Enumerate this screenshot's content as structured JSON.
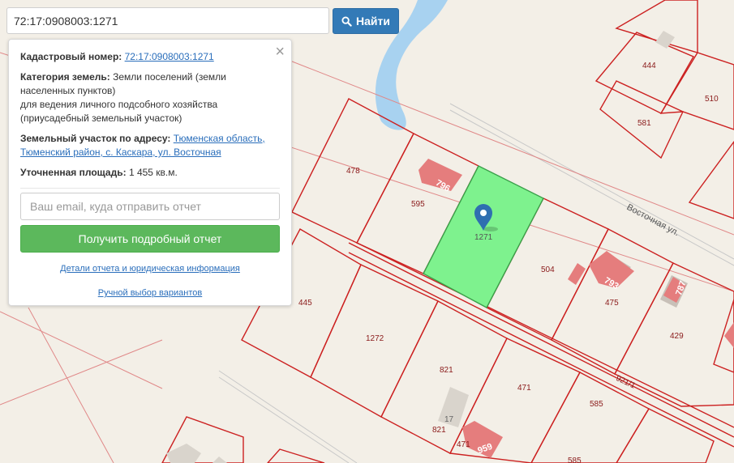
{
  "search": {
    "value": "72:17:0908003:1271",
    "button_label": "Найти",
    "button_icon": "search-icon"
  },
  "info": {
    "cadastral_label": "Кадастровый номер:",
    "cadastral_value": "72:17:0908003:1271",
    "category_label": "Категория земель:",
    "category_line1": "Земли поселений (земли",
    "category_line2": "населенных пунктов)",
    "category_line3": "для ведения личного подсобного хозяйства",
    "category_line4": "(приусадебный земельный участок)",
    "address_label": "Земельный участок по адресу:",
    "address_line1": "Тюменская область,",
    "address_line2": "Тюменский район, с. Каскара, ул. Восточная",
    "area_label": "Уточненная площадь:",
    "area_value": "1 455 кв.м.",
    "email_placeholder": "Ваш email, куда отправить отчет",
    "report_button": "Получить подробный отчет",
    "details_link": "Детали отчета и юридическая информация",
    "manual_link": "Ручной выбор вариантов",
    "close_icon": "close-icon"
  },
  "map": {
    "street_name": "Восточная ул.",
    "selected_parcel_label": "1271",
    "parcels": [
      "444",
      "510",
      "581",
      "478",
      "595",
      "504",
      "445",
      "1272",
      "821",
      "471",
      "585",
      "475",
      "429",
      "17",
      "821",
      "471",
      "585"
    ],
    "buildings": [
      "796",
      "793",
      "787",
      "959"
    ],
    "road_label": "921/1",
    "marker_icon": "map-pin-icon",
    "colors": {
      "selected_fill": "#7ef28e",
      "boundary": "#cc2121",
      "water": "#a8d2f0",
      "building": "#e57d7d",
      "background": "#f3efe7"
    }
  }
}
